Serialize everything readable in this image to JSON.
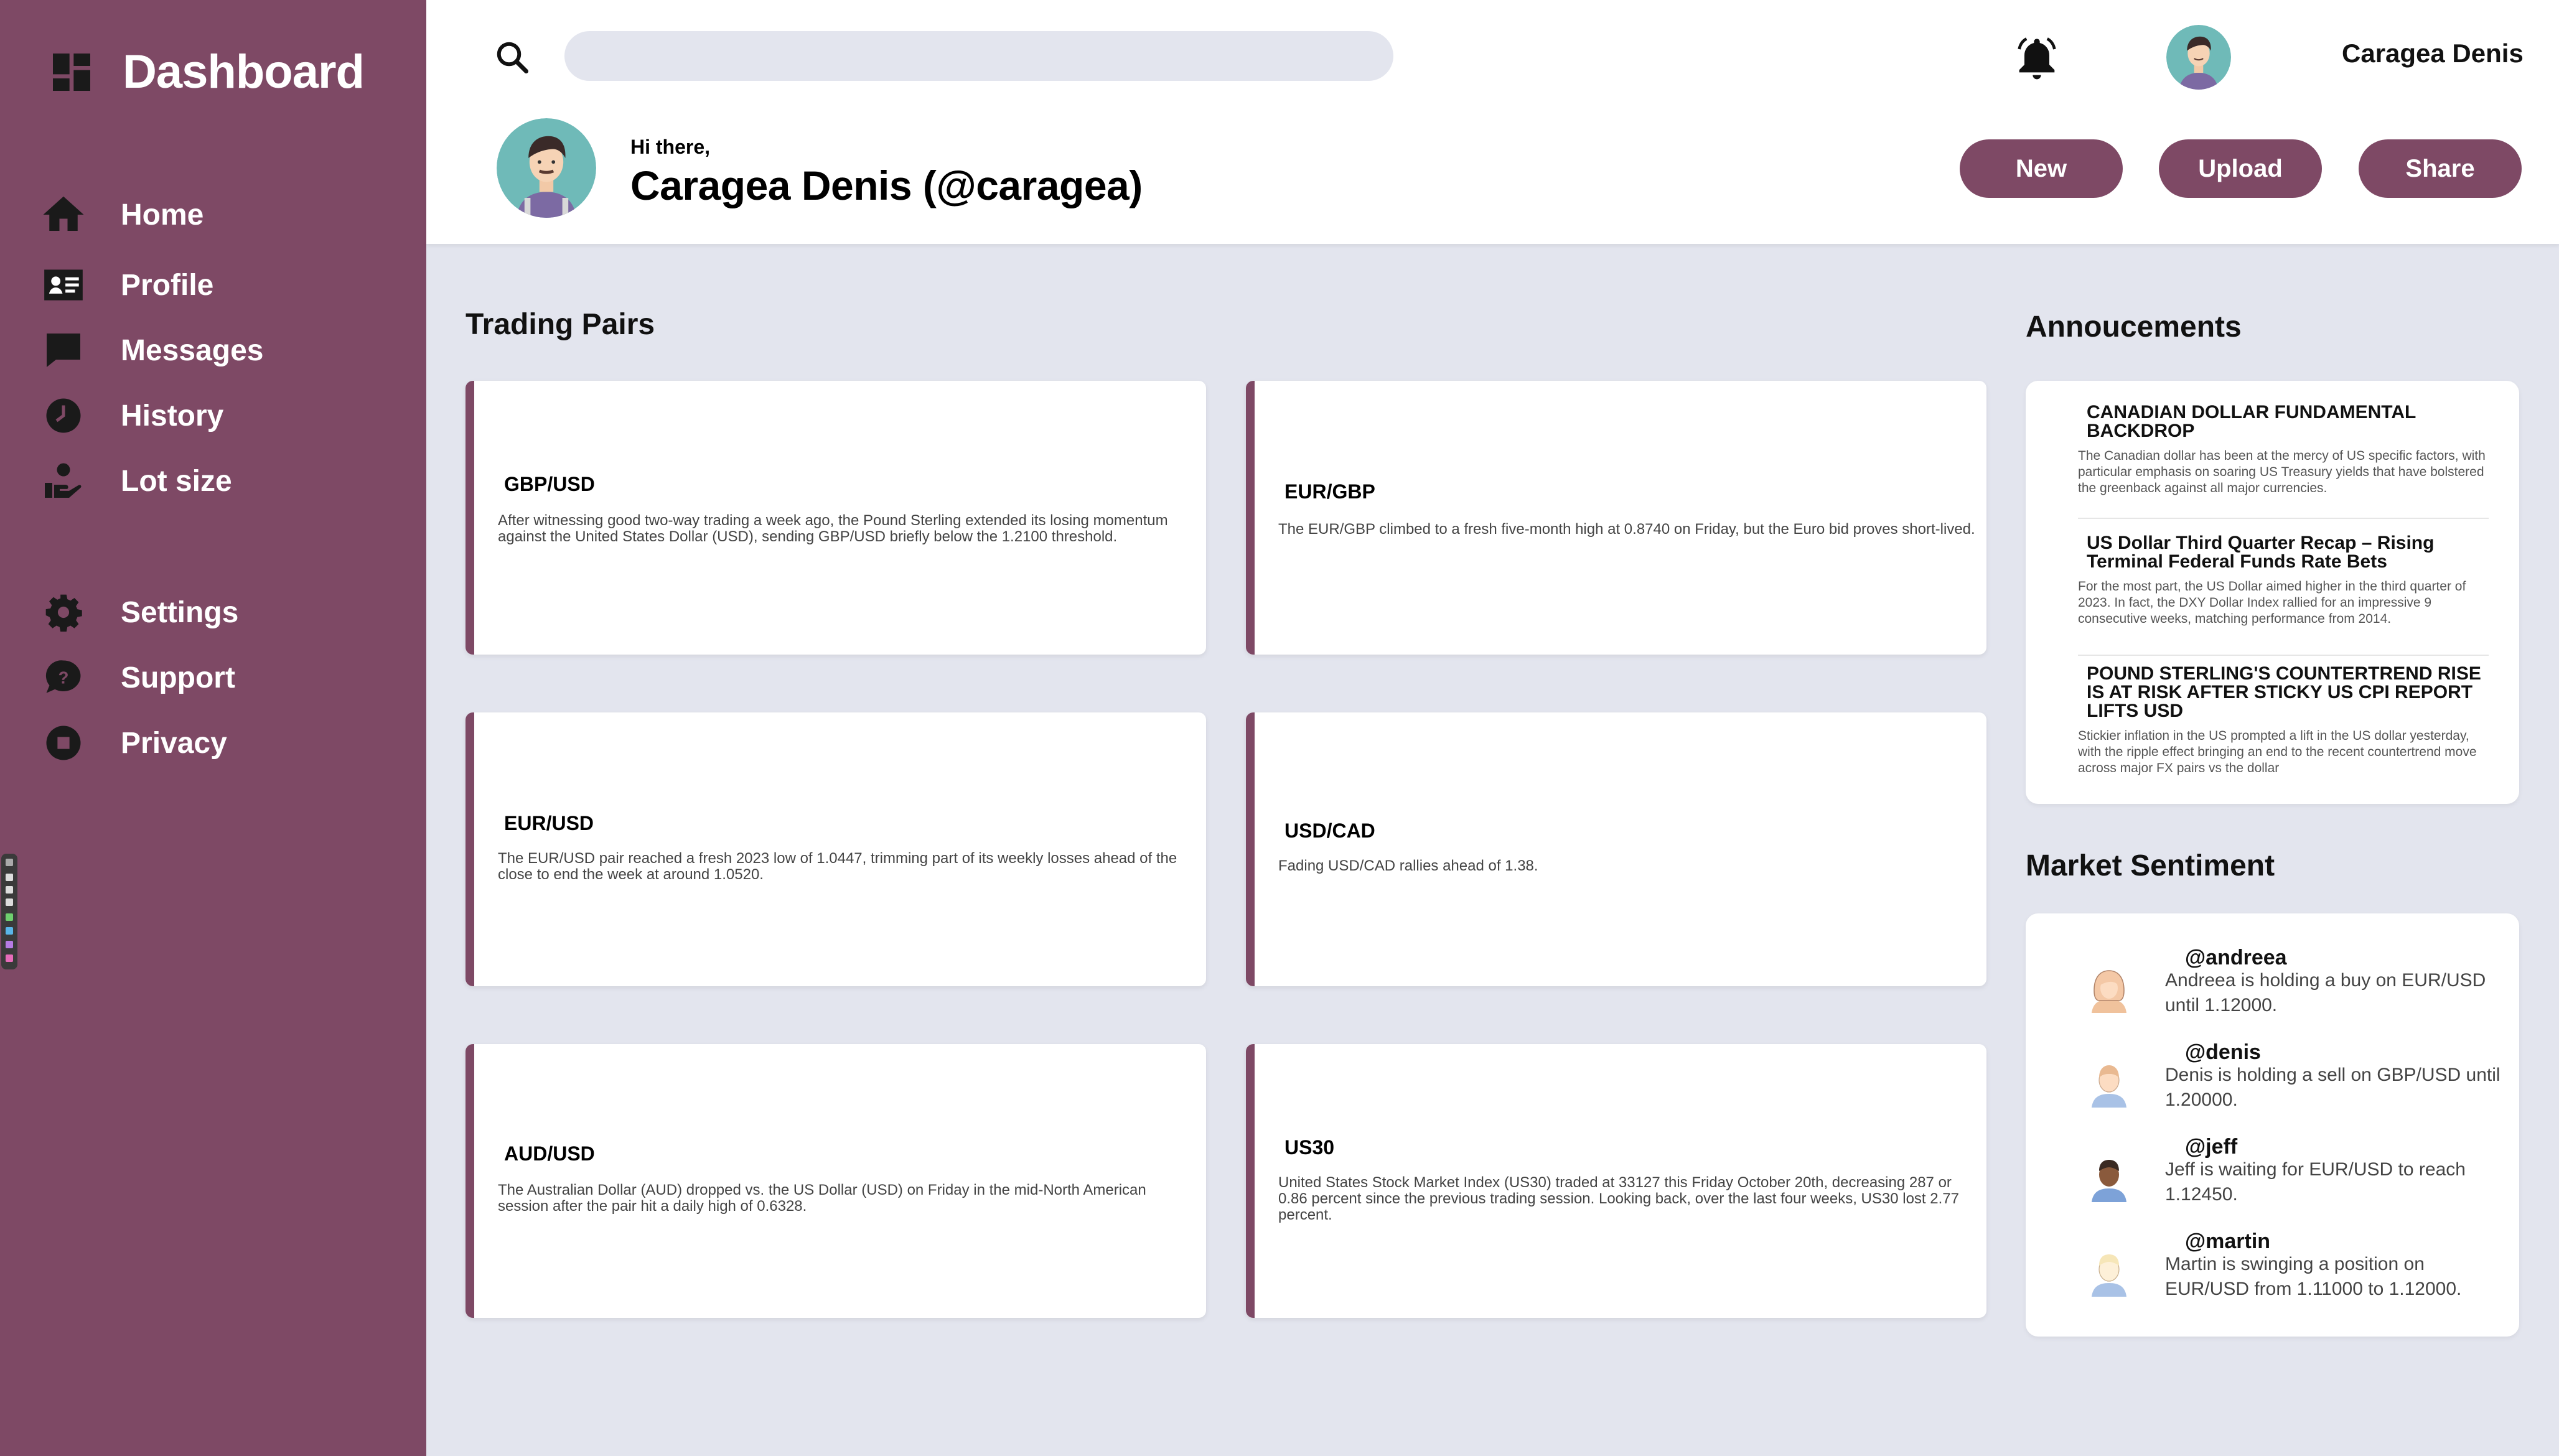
{
  "sidebar": {
    "brand": "Dashboard",
    "items": [
      {
        "label": "Home",
        "icon": "home-icon"
      },
      {
        "label": "Profile",
        "icon": "id-card-icon"
      },
      {
        "label": "Messages",
        "icon": "chat-icon"
      },
      {
        "label": "History",
        "icon": "clock-icon"
      },
      {
        "label": "Lot size",
        "icon": "hand-coin-icon"
      },
      {
        "label": "Settings",
        "icon": "gear-icon"
      },
      {
        "label": "Support",
        "icon": "help-bubble-icon"
      },
      {
        "label": "Privacy",
        "icon": "record-icon"
      }
    ],
    "accent_color": "#7e4965"
  },
  "topbar": {
    "search_placeholder": "",
    "user_name": "Caragea Denis"
  },
  "profile": {
    "greeting": "Hi there,",
    "full_name": "Caragea Denis (@caragea)"
  },
  "actions": {
    "new_label": "New",
    "upload_label": "Upload",
    "share_label": "Share"
  },
  "trading": {
    "title": "Trading Pairs",
    "pairs": [
      {
        "pair": "GBP/USD",
        "desc": "After witnessing good two-way trading a week ago, the Pound Sterling extended its losing momentum against the United States Dollar (USD), sending GBP/USD briefly below the 1.2100 threshold."
      },
      {
        "pair": "EUR/GBP",
        "desc": "The EUR/GBP climbed to a fresh five-month high at 0.8740 on Friday, but the Euro bid proves short-lived."
      },
      {
        "pair": "EUR/USD",
        "desc": "The EUR/USD pair reached a fresh 2023 low of 1.0447, trimming part of its weekly losses ahead of the close to end the week at around 1.0520."
      },
      {
        "pair": "USD/CAD",
        "desc": "Fading USD/CAD rallies ahead of 1.38."
      },
      {
        "pair": "AUD/USD",
        "desc": "The Australian Dollar (AUD) dropped vs. the US Dollar (USD) on Friday in the mid-North American session after the pair hit a daily high of 0.6328."
      },
      {
        "pair": "US30",
        "desc": "United States Stock Market Index (US30) traded at 33127 this Friday October 20th, decreasing 287 or 0.86 percent since the previous trading session. Looking back, over the last four weeks, US30 lost 2.77 percent."
      }
    ]
  },
  "announcements": {
    "title": "Annoucements",
    "items": [
      {
        "title": "CANADIAN DOLLAR FUNDAMENTAL BACKDROP",
        "desc": "The Canadian dollar has been at the mercy of US specific factors, with particular emphasis on soaring US Treasury yields that have bolstered the greenback against all major currencies."
      },
      {
        "title": "US Dollar Third Quarter Recap – Rising Terminal Federal Funds Rate Bets",
        "desc": "For the most part, the US Dollar aimed higher in the third quarter of 2023. In fact, the DXY Dollar Index rallied for an impressive 9 consecutive weeks, matching performance from 2014."
      },
      {
        "title": "POUND STERLING'S COUNTERTREND RISE IS AT RISK AFTER STICKY US CPI REPORT LIFTS USD",
        "desc": "Stickier inflation in the US prompted a lift in the US dollar yesterday, with the ripple effect bringing an end to the recent countertrend move across major FX pairs vs the dollar"
      }
    ]
  },
  "sentiment": {
    "title": "Market Sentiment",
    "items": [
      {
        "handle": "@andreea",
        "message": "Andreea is holding a buy on EUR/USD until 1.12000."
      },
      {
        "handle": "@denis",
        "message": "Denis is holding a sell on GBP/USD until 1.20000."
      },
      {
        "handle": "@jeff",
        "message": "Jeff is waiting for EUR/USD to reach 1.12450."
      },
      {
        "handle": "@martin",
        "message": "Martin is swinging a position on EUR/USD from 1.11000 to 1.12000."
      }
    ]
  }
}
